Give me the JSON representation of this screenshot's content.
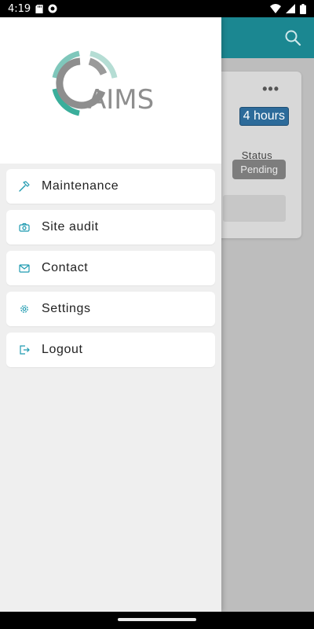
{
  "status_bar": {
    "time": "4:19"
  },
  "app": {
    "card": {
      "more_label": "•••",
      "duration": "4 hours",
      "status_label": "Status",
      "status_value": "Pending"
    }
  },
  "drawer": {
    "logo_text": "AIMS",
    "menu": [
      {
        "label": "Maintenance",
        "icon": "hammer-icon"
      },
      {
        "label": "Site audit",
        "icon": "camera-icon"
      },
      {
        "label": "Contact",
        "icon": "mail-icon"
      },
      {
        "label": "Settings",
        "icon": "gear-icon"
      },
      {
        "label": "Logout",
        "icon": "logout-icon"
      }
    ]
  },
  "colors": {
    "accent": "#1b8791",
    "icon": "#1e9ab0",
    "logo_teal": "#3aae9b",
    "logo_grey": "#8e8e8e",
    "status_badge": "#7d7d7d",
    "duration_badge": "#2d6b9a"
  }
}
